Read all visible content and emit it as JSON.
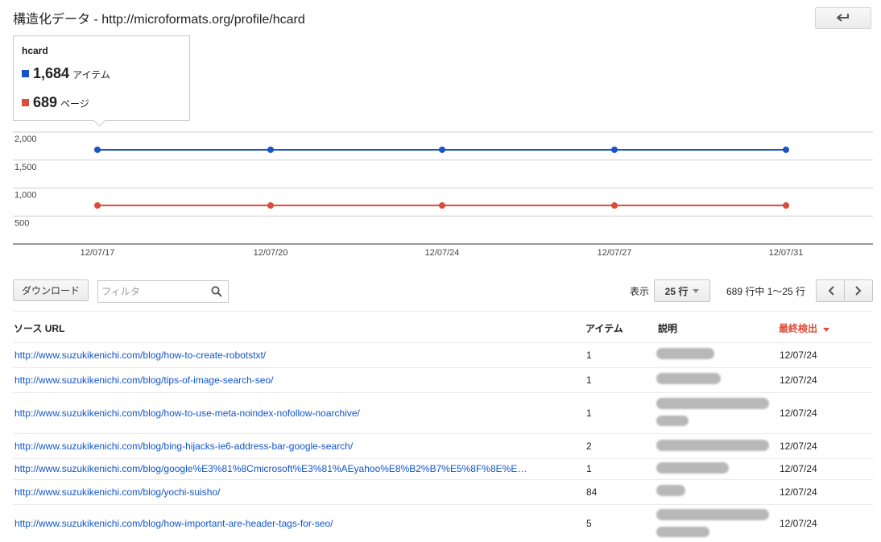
{
  "header": {
    "title": "構造化データ - http://microformats.org/profile/hcard",
    "back_icon": "back-arrow-icon"
  },
  "legend": {
    "title": "hcard",
    "items": [
      {
        "color": "#1a53c9",
        "value": "1,684",
        "unit": "アイテム"
      },
      {
        "color": "#dd4b39",
        "value": "689",
        "unit": "ページ"
      }
    ]
  },
  "chart_data": {
    "type": "line",
    "x": [
      "12/07/17",
      "12/07/20",
      "12/07/24",
      "12/07/27",
      "12/07/31"
    ],
    "y_ticks": [
      "2,000",
      "1,500",
      "1,000",
      "500"
    ],
    "y_tick_values": [
      2000,
      1500,
      1000,
      500
    ],
    "ylim": [
      0,
      2000
    ],
    "grid": true,
    "series": [
      {
        "name": "アイテム",
        "color": "#1a53c9",
        "values": [
          1684,
          1684,
          1684,
          1684,
          1684
        ]
      },
      {
        "name": "ページ",
        "color": "#dd4b39",
        "values": [
          689,
          689,
          689,
          689,
          689
        ]
      }
    ]
  },
  "toolbar": {
    "download_label": "ダウンロード",
    "filter_placeholder": "フィルタ",
    "search_icon": "search-icon",
    "show_label": "表示",
    "rows_value": "25 行",
    "range_text": "689 行中 1〜25 行",
    "prev_icon": "chevron-left-icon",
    "next_icon": "chevron-right-icon"
  },
  "table": {
    "headers": {
      "source_url": "ソース URL",
      "items": "アイテム",
      "description": "説明",
      "last_detected": "最終検出"
    },
    "rows": [
      {
        "url": "http://www.suzukikenichi.com/blog/how-to-create-robotstxt/",
        "items": "1",
        "date": "12/07/24"
      },
      {
        "url": "http://www.suzukikenichi.com/blog/tips-of-image-search-seo/",
        "items": "1",
        "date": "12/07/24"
      },
      {
        "url": "http://www.suzukikenichi.com/blog/how-to-use-meta-noindex-nofollow-noarchive/",
        "items": "1",
        "date": "12/07/24"
      },
      {
        "url": "http://www.suzukikenichi.com/blog/bing-hijacks-ie6-address-bar-google-search/",
        "items": "2",
        "date": "12/07/24"
      },
      {
        "url": "http://www.suzukikenichi.com/blog/google%E3%81%8Cmicrosoft%E3%81%AEyahoo%E8%B2%B7%E5%8F%8E%E…",
        "items": "1",
        "date": "12/07/24"
      },
      {
        "url": "http://www.suzukikenichi.com/blog/yochi-suisho/",
        "items": "84",
        "date": "12/07/24"
      },
      {
        "url": "http://www.suzukikenichi.com/blog/how-important-are-header-tags-for-seo/",
        "items": "5",
        "date": "12/07/24"
      }
    ]
  }
}
